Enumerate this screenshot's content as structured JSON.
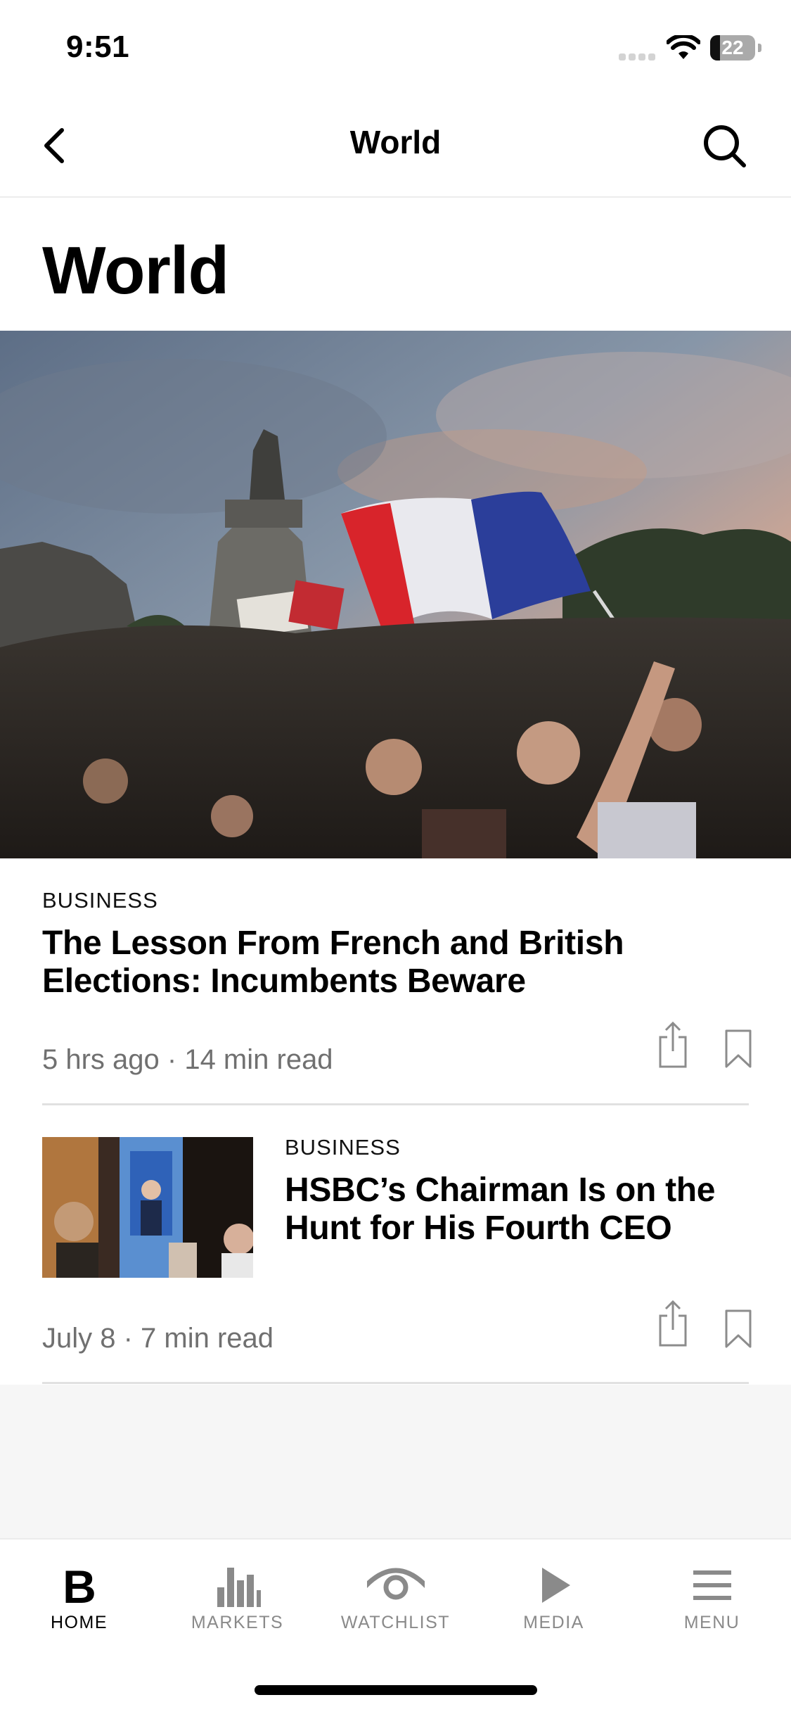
{
  "status_bar": {
    "time": "9:51",
    "battery_level": "22"
  },
  "nav": {
    "title": "World"
  },
  "page": {
    "title": "World"
  },
  "articles": [
    {
      "category": "BUSINESS",
      "headline": "The Lesson From French and British Elections: Incumbents Beware",
      "meta": "5 hrs ago · 14 min read"
    },
    {
      "category": "BUSINESS",
      "headline": "HSBC’s Chairman Is on the Hunt for His Fourth CEO",
      "meta": "July 8 · 7 min read"
    }
  ],
  "tabs": [
    {
      "label": "HOME",
      "icon": "brand-b-icon",
      "active": true
    },
    {
      "label": "MARKETS",
      "icon": "bar-chart-icon",
      "active": false
    },
    {
      "label": "WATCHLIST",
      "icon": "eye-icon",
      "active": false
    },
    {
      "label": "MEDIA",
      "icon": "play-icon",
      "active": false
    },
    {
      "label": "MENU",
      "icon": "hamburger-icon",
      "active": false
    }
  ],
  "colors": {
    "accent": "#000000",
    "muted": "#8a8a8a",
    "divider": "#e1e1e1"
  }
}
